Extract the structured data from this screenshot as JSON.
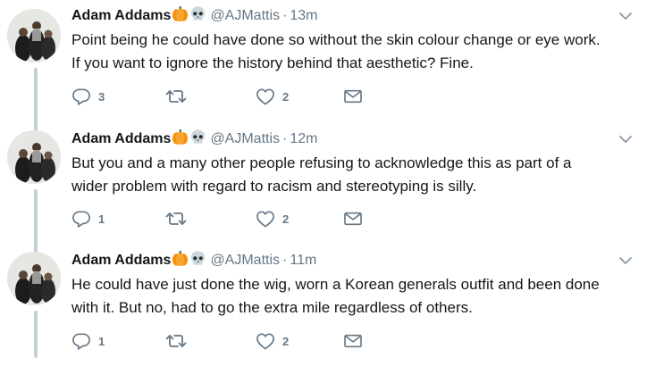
{
  "tweets": [
    {
      "author_name": "Adam Addams",
      "emoji": [
        "pumpkin-icon",
        "skull-icon"
      ],
      "handle": "@AJMattis",
      "separator": "·",
      "time": "13m",
      "text_lines": [
        "Point being he could have done so without the skin colour change or eye work.",
        "If you want to ignore the history behind that aesthetic? Fine."
      ],
      "reply_count": "3",
      "retweet_count": "",
      "like_count": "2"
    },
    {
      "author_name": "Adam Addams",
      "emoji": [
        "pumpkin-icon",
        "skull-icon"
      ],
      "handle": "@AJMattis",
      "separator": "·",
      "time": "12m",
      "text_lines": [
        "But you and a many other people refusing to acknowledge this as part of a",
        "wider problem with regard to racism and stereotyping is silly."
      ],
      "reply_count": "1",
      "retweet_count": "",
      "like_count": "2"
    },
    {
      "author_name": "Adam Addams",
      "emoji": [
        "pumpkin-icon",
        "skull-icon"
      ],
      "handle": "@AJMattis",
      "separator": "·",
      "time": "11m",
      "text_lines": [
        "He could have just done the wig, worn a Korean generals outfit and been done",
        "with it. But no, had to go the extra mile regardless of others."
      ],
      "reply_count": "1",
      "retweet_count": "",
      "like_count": "2"
    }
  ],
  "colors": {
    "text": "#14171a",
    "secondary": "#657786",
    "thread_line": "#c4cfd6",
    "pumpkin": "#f4900c"
  }
}
